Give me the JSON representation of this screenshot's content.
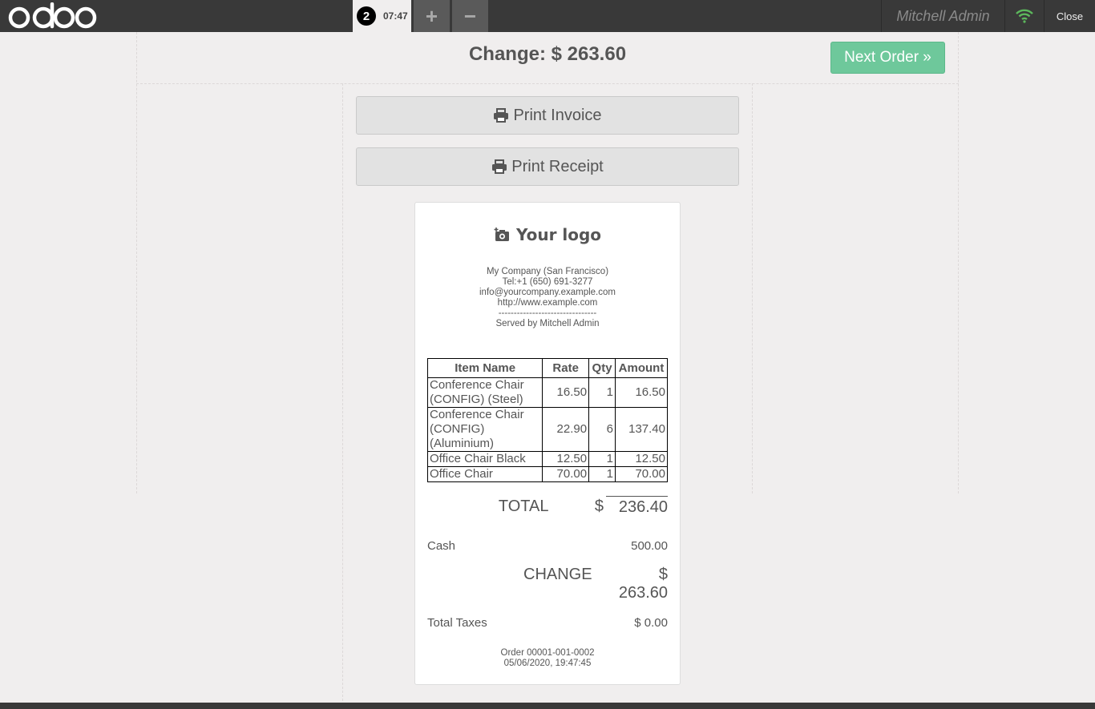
{
  "header": {
    "brand": "odoo",
    "order_tab": {
      "number": "2",
      "time": "07:47"
    },
    "add_label": "+",
    "remove_label": "−",
    "user": "Mitchell Admin",
    "close_label": "Close",
    "wifi_color": "#5cb85c"
  },
  "screen": {
    "change_title": "Change: $ 263.60",
    "next_label": "Next Order »",
    "print_invoice_label": "Print Invoice",
    "print_receipt_label": "Print Receipt"
  },
  "receipt": {
    "logo_text": "Your logo",
    "company": "My Company (San Francisco)",
    "tel": "Tel:+1 (650) 691-3277",
    "email": "info@yourcompany.example.com",
    "website": "http://www.example.com",
    "separator": "--------------------------------",
    "served_by": "Served by Mitchell Admin",
    "columns": [
      "Item Name",
      "Rate",
      "Qty",
      "Amount"
    ],
    "items": [
      {
        "name": "Conference Chair (CONFIG) (Steel)",
        "rate": "16.50",
        "qty": "1",
        "amount": "16.50"
      },
      {
        "name": "Conference Chair (CONFIG) (Aluminium)",
        "rate": "22.90",
        "qty": "6",
        "amount": "137.40"
      },
      {
        "name": "Office Chair Black",
        "rate": "12.50",
        "qty": "1",
        "amount": "12.50"
      },
      {
        "name": "Office Chair",
        "rate": "70.00",
        "qty": "1",
        "amount": "70.00"
      }
    ],
    "total_label": "TOTAL",
    "total_currency": "$",
    "total_value": "236.40",
    "cash_label": "Cash",
    "cash_value": "500.00",
    "change_label": "CHANGE",
    "change_value": "$ 263.60",
    "taxes_label": "Total Taxes",
    "taxes_value": "$ 0.00",
    "order_ref": "Order 00001-001-0002",
    "order_date": "05/06/2020, 19:47:45"
  }
}
